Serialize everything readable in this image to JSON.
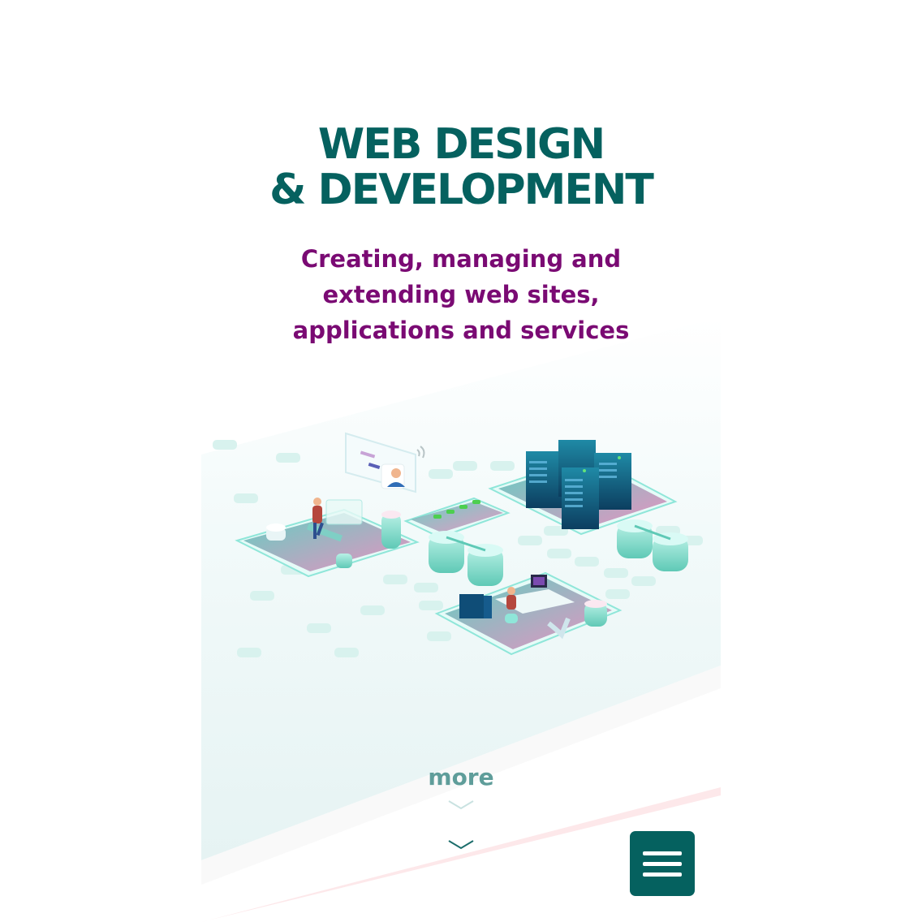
{
  "hero": {
    "title_line1": "WEB DESIGN",
    "title_line2": "& DEVELOPMENT",
    "subtitle_line1": "Creating, managing and",
    "subtitle_line2": "extending web sites,",
    "subtitle_line3": "applications and services"
  },
  "scroll": {
    "more_label": "more",
    "chevron_icon": "chevron-down-icon"
  },
  "menu": {
    "icon": "hamburger-menu-icon"
  },
  "colors": {
    "title": "#05615f",
    "subtitle": "#7a0a73",
    "more": "#5f9d9a",
    "menu_button": "#05615f",
    "accent_pink": "#e77fb7",
    "accent_teal": "#8fe6d9"
  }
}
